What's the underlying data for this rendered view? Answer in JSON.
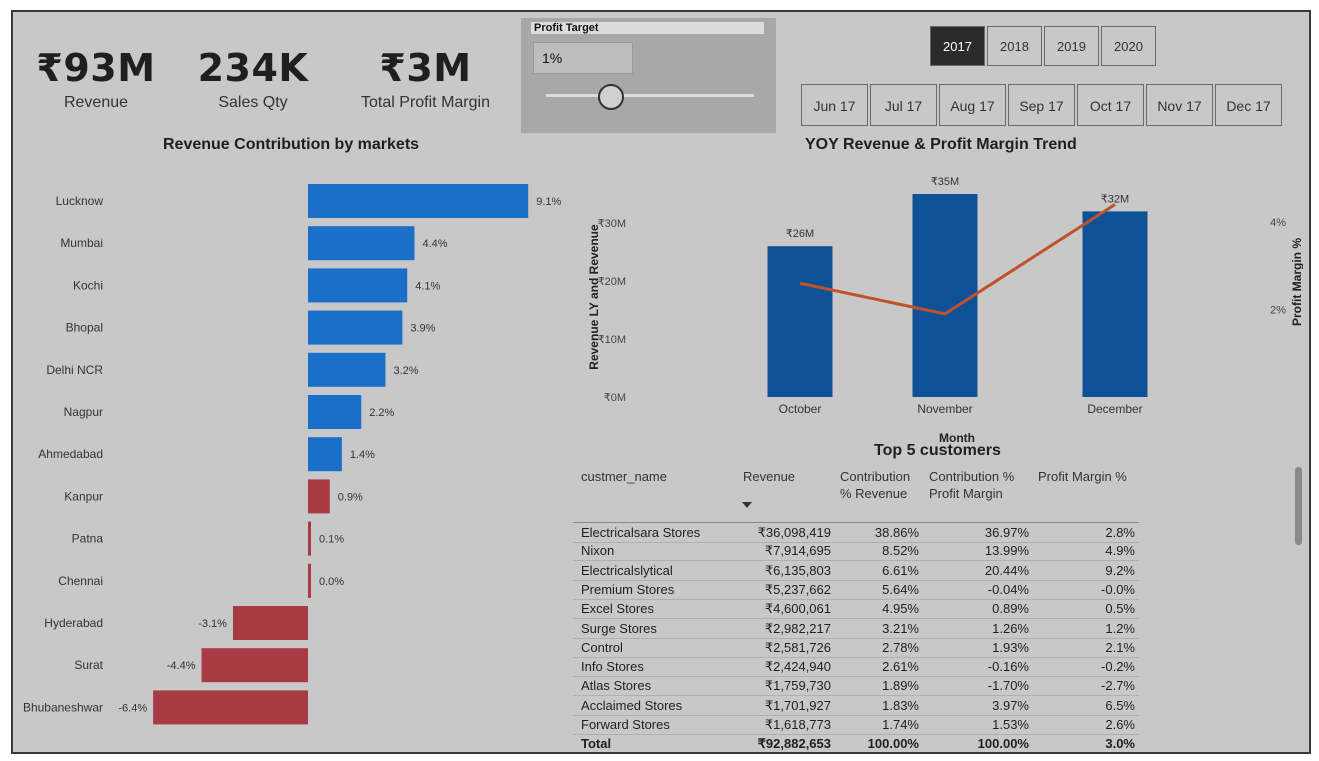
{
  "kpis": [
    {
      "value": "₹93M",
      "label": "Revenue"
    },
    {
      "value": "234K",
      "label": "Sales Qty"
    },
    {
      "value": "₹3M",
      "label": "Total Profit Margin"
    }
  ],
  "profit_target": {
    "title": "Profit Target",
    "value": "1%",
    "slider_fraction": 0.3
  },
  "years": [
    {
      "label": "2017",
      "selected": true
    },
    {
      "label": "2018",
      "selected": false
    },
    {
      "label": "2019",
      "selected": false
    },
    {
      "label": "2020",
      "selected": false
    }
  ],
  "months": [
    "Jun 17",
    "Jul 17",
    "Aug 17",
    "Sep 17",
    "Oct 17",
    "Nov 17",
    "Dec 17"
  ],
  "colors": {
    "positive_bar": "#1a6fc9",
    "negative_bar": "#a83a44",
    "revenue_bar": "#0e5196",
    "margin_line": "#c0522b",
    "background": "#c8c8c8"
  },
  "chart_data": [
    {
      "type": "bar",
      "orientation": "horizontal",
      "title": "Revenue Contribution by markets",
      "categories": [
        "Lucknow",
        "Mumbai",
        "Kochi",
        "Bhopal",
        "Delhi NCR",
        "Nagpur",
        "Ahmedabad",
        "Kanpur",
        "Patna",
        "Chennai",
        "Hyderabad",
        "Surat",
        "Bhubaneshwar"
      ],
      "values": [
        9.1,
        4.4,
        4.1,
        3.9,
        3.2,
        2.2,
        1.4,
        0.9,
        0.1,
        0.0,
        -3.1,
        -4.4,
        -6.4
      ],
      "value_labels": [
        "9.1%",
        "4.4%",
        "4.1%",
        "3.9%",
        "3.2%",
        "2.2%",
        "1.4%",
        "0.9%",
        "0.1%",
        "0.0%",
        "-3.1%",
        "-4.4%",
        "-6.4%"
      ],
      "highlight_red": [
        false,
        false,
        false,
        false,
        false,
        false,
        false,
        true,
        true,
        true,
        true,
        true,
        true
      ],
      "unit": "%"
    },
    {
      "type": "bar+line",
      "title": "YOY Revenue & Profit Margin Trend",
      "xlabel": "Month",
      "ylabel": "Revenue LY and Revenue",
      "y2label": "Profit Margin %",
      "categories": [
        "October",
        "November",
        "December"
      ],
      "series": [
        {
          "name": "Revenue",
          "type": "bar",
          "values": [
            26,
            35,
            32
          ],
          "labels": [
            "₹26M",
            "₹35M",
            "₹32M"
          ]
        },
        {
          "name": "Profit Margin %",
          "type": "line",
          "axis": "y2",
          "values": [
            2.6,
            1.9,
            4.4
          ]
        }
      ],
      "ylim": [
        0,
        35
      ],
      "yticks": [
        "₹0M",
        "₹10M",
        "₹20M",
        "₹30M"
      ],
      "y2ticks": [
        "2%",
        "4%"
      ],
      "y2lim": [
        0,
        4.8
      ]
    }
  ],
  "table": {
    "title": "Top 5 customers",
    "headers": [
      "custmer_name",
      "Revenue",
      "Contribution % Revenue",
      "Contribution % Profit Margin",
      "Profit Margin %"
    ],
    "rows": [
      [
        "Electricalsara Stores",
        "₹36,098,419",
        "38.86%",
        "36.97%",
        "2.8%"
      ],
      [
        "Nixon",
        "₹7,914,695",
        "8.52%",
        "13.99%",
        "4.9%"
      ],
      [
        "Electricalslytical",
        "₹6,135,803",
        "6.61%",
        "20.44%",
        "9.2%"
      ],
      [
        "Premium Stores",
        "₹5,237,662",
        "5.64%",
        "-0.04%",
        "-0.0%"
      ],
      [
        "Excel Stores",
        "₹4,600,061",
        "4.95%",
        "0.89%",
        "0.5%"
      ],
      [
        "Surge Stores",
        "₹2,982,217",
        "3.21%",
        "1.26%",
        "1.2%"
      ],
      [
        "Control",
        "₹2,581,726",
        "2.78%",
        "1.93%",
        "2.1%"
      ],
      [
        "Info Stores",
        "₹2,424,940",
        "2.61%",
        "-0.16%",
        "-0.2%"
      ],
      [
        "Atlas Stores",
        "₹1,759,730",
        "1.89%",
        "-1.70%",
        "-2.7%"
      ],
      [
        "Acclaimed Stores",
        "₹1,701,927",
        "1.83%",
        "3.97%",
        "6.5%"
      ],
      [
        "Forward Stores",
        "₹1,618,773",
        "1.74%",
        "1.53%",
        "2.6%"
      ]
    ],
    "total": [
      "Total",
      "₹92,882,653",
      "100.00%",
      "100.00%",
      "3.0%"
    ]
  }
}
